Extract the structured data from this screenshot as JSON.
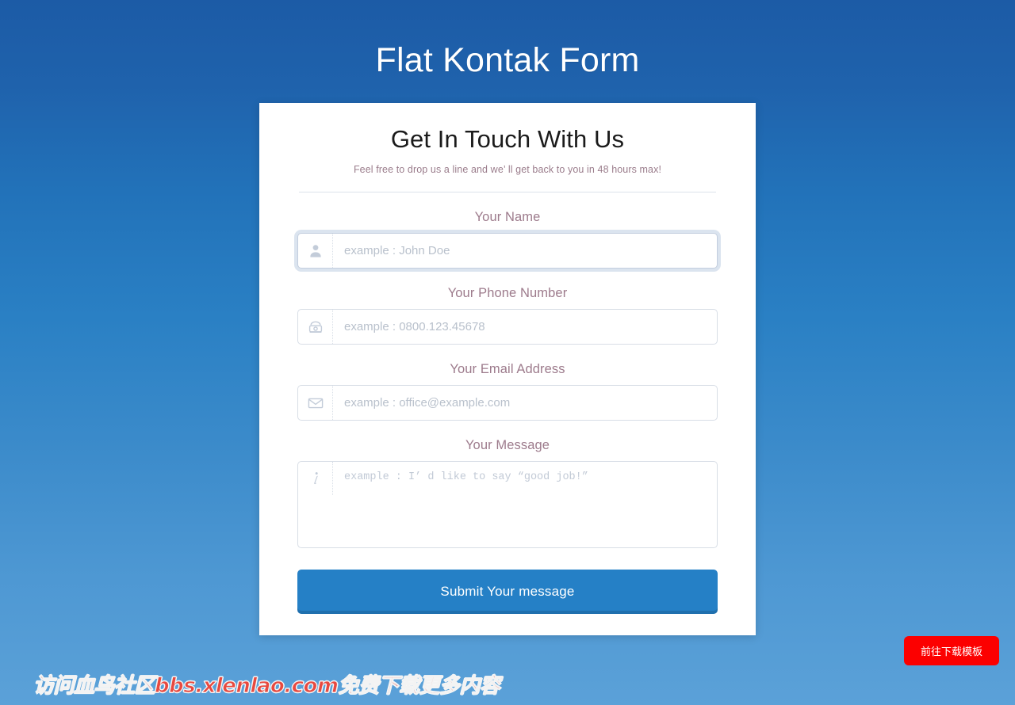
{
  "page": {
    "title": "Flat Kontak Form",
    "background_top_color": "#1c5ba6",
    "background_bottom_color": "#5ba1d8"
  },
  "card": {
    "heading": "Get In Touch With Us",
    "subtitle": "Feel free to drop us a line and we’ ll get back to you in 48 hours max!",
    "heading_color": "#1b1b1b",
    "subtitle_color": "#9b7d8c",
    "divider_color": "#dde3ea",
    "background_color": "#ffffff"
  },
  "form": {
    "label_color": "#9d7b8c",
    "fields": [
      {
        "id": "name",
        "label": "Your Name",
        "placeholder": "example : John Doe",
        "value": "",
        "icon": "user-icon",
        "focused": true,
        "type": "input"
      },
      {
        "id": "phone",
        "label": "Your Phone Number",
        "placeholder": "example : 0800.123.45678",
        "value": "",
        "icon": "telephone-icon",
        "focused": false,
        "type": "input"
      },
      {
        "id": "email",
        "label": "Your Email Address",
        "placeholder": "example : office@example.com",
        "value": "",
        "icon": "envelope-icon",
        "focused": false,
        "type": "input"
      },
      {
        "id": "message",
        "label": "Your Message",
        "placeholder": "example : I’ d like to say “good job!”",
        "value": "",
        "icon": "info-icon",
        "focused": false,
        "type": "textarea"
      }
    ],
    "submit_label": "Submit Your message",
    "submit_color": "#2580c6"
  },
  "watermark": {
    "text": "访问血鸟社区bbs.xlenlao.com免费下载更多内容",
    "color": "#e8493f"
  },
  "download_button": {
    "label": "前往下载模板",
    "color": "#fc0000"
  }
}
